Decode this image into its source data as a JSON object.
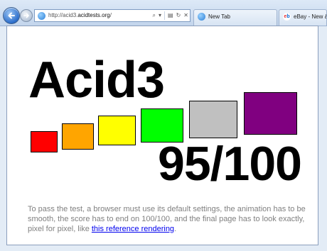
{
  "browser": {
    "address": {
      "prefix": "http://acid3.",
      "domain": "acidtests.org",
      "suffix": "/"
    },
    "tabs": [
      {
        "label": "New Tab",
        "icon": "ie-icon"
      },
      {
        "label": "eBay - New & u",
        "icon": "ebay-icon"
      }
    ],
    "ebay_logo": {
      "e": "e",
      "b": "b"
    }
  },
  "page": {
    "title": "Acid3",
    "score": "95/100",
    "description_prefix": "To pass the test, a browser must use its default settings, the animation has to be smooth, the score has to end on 100/100, and the final page has to look exactly, pixel for pixel, like ",
    "link_text": "this reference rendering",
    "description_suffix": ".",
    "boxes": [
      {
        "color": "#ff0000"
      },
      {
        "color": "#ffa500"
      },
      {
        "color": "#ffff00"
      },
      {
        "color": "#00ff00"
      },
      {
        "color": "#c0c0c0"
      },
      {
        "color": "#800080"
      }
    ]
  }
}
